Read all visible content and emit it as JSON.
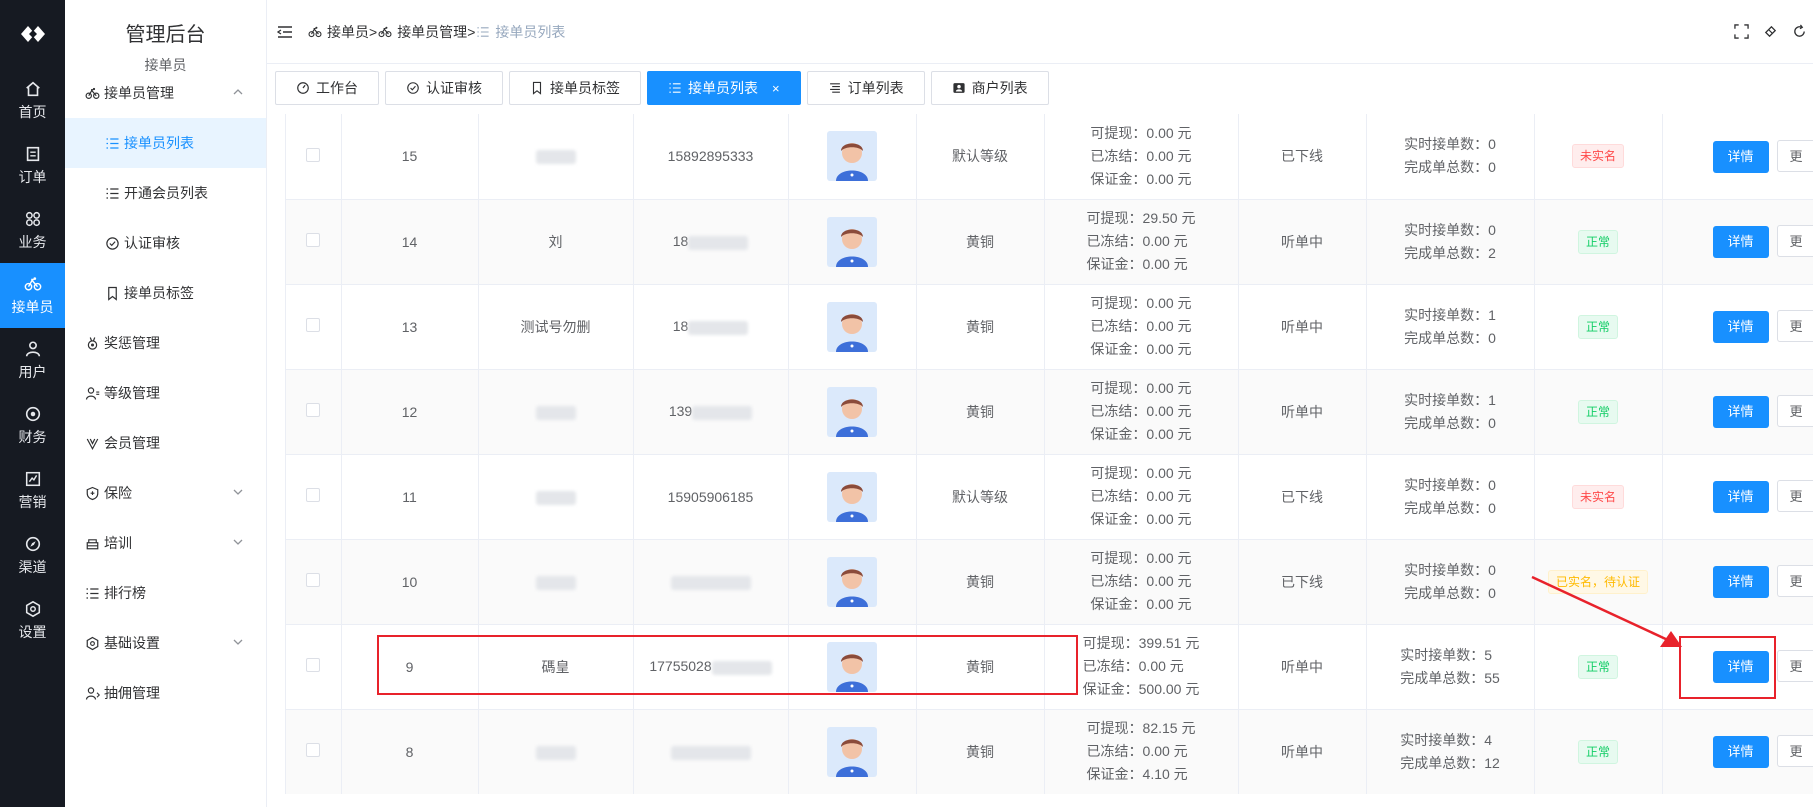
{
  "rail": {
    "items": [
      {
        "label": "首页",
        "icon": "home-icon"
      },
      {
        "label": "订单",
        "icon": "order-icon"
      },
      {
        "label": "业务",
        "icon": "grid-icon"
      },
      {
        "label": "接单员",
        "icon": "bike-icon",
        "active": true
      },
      {
        "label": "用户",
        "icon": "user-icon"
      },
      {
        "label": "财务",
        "icon": "finance-icon"
      },
      {
        "label": "营销",
        "icon": "chart-icon"
      },
      {
        "label": "渠道",
        "icon": "compass-icon"
      },
      {
        "label": "设置",
        "icon": "settings-icon"
      }
    ]
  },
  "sidebar": {
    "title": "管理后台",
    "subtitle": "接单员",
    "menu": [
      {
        "label": "接单员管理",
        "icon": "bike-icon",
        "level": 1,
        "expanded": true
      },
      {
        "label": "接单员列表",
        "icon": "list-icon",
        "level": 2,
        "active": true
      },
      {
        "label": "开通会员列表",
        "icon": "list-icon",
        "level": 2
      },
      {
        "label": "认证审核",
        "icon": "check-circle-icon",
        "level": 2
      },
      {
        "label": "接单员标签",
        "icon": "bookmark-icon",
        "level": 2
      },
      {
        "label": "奖惩管理",
        "icon": "medal-icon",
        "level": 1
      },
      {
        "label": "等级管理",
        "icon": "user-level-icon",
        "level": 1
      },
      {
        "label": "会员管理",
        "icon": "vip-icon",
        "level": 1
      },
      {
        "label": "保险",
        "icon": "shield-icon",
        "level": 1,
        "collapsible": true
      },
      {
        "label": "培训",
        "icon": "training-icon",
        "level": 1,
        "collapsible": true
      },
      {
        "label": "排行榜",
        "icon": "list-icon",
        "level": 1
      },
      {
        "label": "基础设置",
        "icon": "gear-icon",
        "level": 1,
        "collapsible": true
      },
      {
        "label": "抽佣管理",
        "icon": "commission-icon",
        "level": 1
      }
    ]
  },
  "breadcrumb": {
    "items": [
      "接单员",
      "接单员管理",
      "接单员列表"
    ],
    "separator": ">"
  },
  "tags": [
    {
      "label": "工作台",
      "icon": "dashboard-icon"
    },
    {
      "label": "认证审核",
      "icon": "check-circle-icon"
    },
    {
      "label": "接单员标签",
      "icon": "bookmark-icon"
    },
    {
      "label": "接单员列表",
      "icon": "list-icon",
      "active": true,
      "close": "×"
    },
    {
      "label": "订单列表",
      "icon": "lines-icon"
    },
    {
      "label": "商户列表",
      "icon": "merchant-icon"
    }
  ],
  "table": {
    "money_labels": {
      "withdrawable": "可提现：",
      "frozen": "已冻结：",
      "deposit": "保证金："
    },
    "order_labels": {
      "current": "实时接单数：",
      "total": "完成单总数："
    },
    "detail_label": "详情",
    "more_label": "更",
    "rows": [
      {
        "id": "15",
        "name": "",
        "phone": "15892895333",
        "level": "默认等级",
        "withdrawable": "0.00 元",
        "frozen": "0.00 元",
        "deposit": "0.00 元",
        "status": "已下线",
        "current": "0",
        "total": "0",
        "auth": "未实名",
        "auth_type": "no"
      },
      {
        "id": "14",
        "name": "刘",
        "phone": "18",
        "level": "黄铜",
        "withdrawable": "29.50 元",
        "frozen": "0.00 元",
        "deposit": "0.00 元",
        "status": "听单中",
        "current": "0",
        "total": "2",
        "auth": "正常",
        "auth_type": "ok"
      },
      {
        "id": "13",
        "name": "测试号勿删",
        "phone": "18",
        "level": "黄铜",
        "withdrawable": "0.00 元",
        "frozen": "0.00 元",
        "deposit": "0.00 元",
        "status": "听单中",
        "current": "1",
        "total": "0",
        "auth": "正常",
        "auth_type": "ok"
      },
      {
        "id": "12",
        "name": "",
        "phone": "139",
        "level": "黄铜",
        "withdrawable": "0.00 元",
        "frozen": "0.00 元",
        "deposit": "0.00 元",
        "status": "听单中",
        "current": "1",
        "total": "0",
        "auth": "正常",
        "auth_type": "ok"
      },
      {
        "id": "11",
        "name": "",
        "phone": "15905906185",
        "level": "默认等级",
        "withdrawable": "0.00 元",
        "frozen": "0.00 元",
        "deposit": "0.00 元",
        "status": "已下线",
        "current": "0",
        "total": "0",
        "auth": "未实名",
        "auth_type": "no"
      },
      {
        "id": "10",
        "name": "",
        "phone": "",
        "level": "黄铜",
        "withdrawable": "0.00 元",
        "frozen": "0.00 元",
        "deposit": "0.00 元",
        "status": "已下线",
        "current": "0",
        "total": "0",
        "auth": "已实名，待认证",
        "auth_type": "wait"
      },
      {
        "id": "9",
        "name": "碼皇",
        "phone": "17755028",
        "level": "黄铜",
        "withdrawable": "399.51 元",
        "frozen": "0.00 元",
        "deposit": "500.00 元",
        "status": "听单中",
        "current": "5",
        "total": "55",
        "auth": "正常",
        "auth_type": "ok"
      },
      {
        "id": "8",
        "name": "",
        "phone": "",
        "level": "黄铜",
        "withdrawable": "82.15 元",
        "frozen": "0.00 元",
        "deposit": "4.10 元",
        "status": "听单中",
        "current": "4",
        "total": "12",
        "auth": "正常",
        "auth_type": "ok"
      }
    ]
  },
  "colors": {
    "primary": "#1890ff",
    "rail_bg": "#161a22",
    "annotation": "#e8222b",
    "success": "#13ce66",
    "danger": "#ff4949",
    "warning": "#ffba00"
  }
}
